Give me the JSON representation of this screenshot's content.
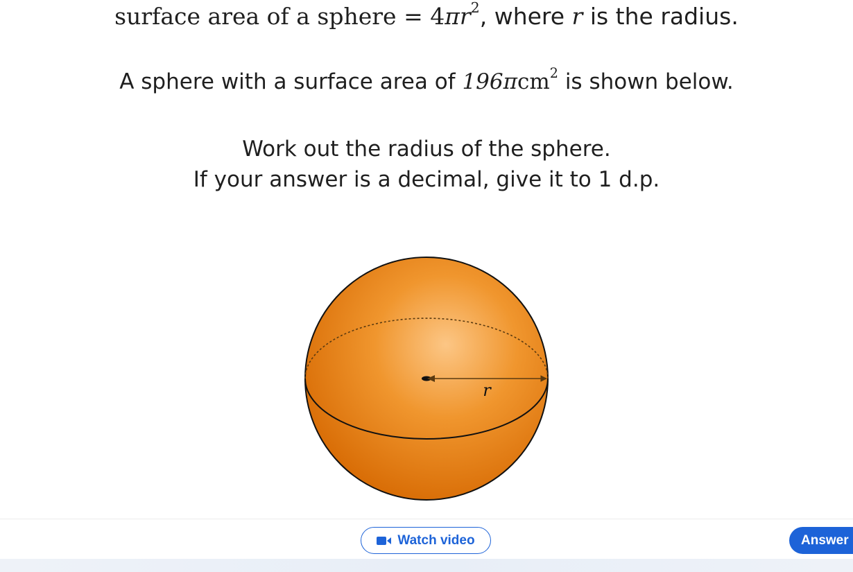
{
  "question": {
    "line1": {
      "prefix": "surface area of a sphere",
      "equals": "=",
      "coef": "4",
      "pi": "π",
      "var": "r",
      "exp": "2",
      "suffix_a": ", where ",
      "var2": "r",
      "suffix_b": " is the radius."
    },
    "line2": {
      "prefix": "A sphere with a surface area of ",
      "value": "196π",
      "unit": "cm",
      "exp": "2",
      "suffix": " is shown below."
    },
    "line3": "Work out the radius of the sphere.",
    "line4": "If your answer is a decimal, give it to 1 d.p."
  },
  "diagram": {
    "radius_label": "r",
    "colors": {
      "sphere_light": "#fcc685",
      "sphere_mid": "#f0962e",
      "sphere_dark": "#d86c05",
      "outline": "#111111"
    }
  },
  "actions": {
    "watch_video_label": "Watch video",
    "answer_label": "Answer",
    "accent_color": "#1d63d8"
  },
  "icons": {
    "watch_video": "video-camera-icon"
  }
}
